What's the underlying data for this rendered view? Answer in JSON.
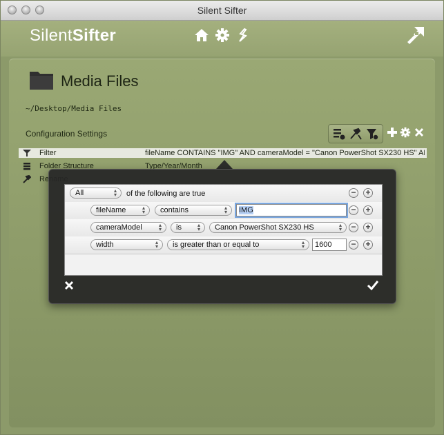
{
  "window": {
    "title": "Silent Sifter"
  },
  "header": {
    "logo_light": "Silent",
    "logo_bold": "Sifter",
    "nav": [
      "home-icon",
      "gear-icon",
      "sifter-icon"
    ],
    "corner_icon": "network-icon"
  },
  "media": {
    "title": "Media Files",
    "path": "~/Desktop/Media Files"
  },
  "config": {
    "label": "Configuration Settings",
    "toolbar": [
      "filter-list-icon",
      "rename-tool-icon",
      "filter-icon"
    ],
    "actions": [
      "add-icon",
      "gear-icon",
      "close-icon"
    ],
    "rows": [
      {
        "icon": "filter-icon",
        "name": "Filter",
        "value": "fileName CONTAINS \"IMG\" AND cameraModel = \"Canon PowerShot SX230 HS\" AND..."
      },
      {
        "icon": "list-icon",
        "name": "Folder Structure",
        "value": "Type/Year/Month"
      },
      {
        "icon": "hammer-icon",
        "name": "Rename",
        "value": ""
      }
    ]
  },
  "predicate": {
    "match_mode": "All",
    "match_suffix": "of the following are true",
    "rules": [
      {
        "field": "fileName",
        "op": "contains",
        "value": "IMG"
      },
      {
        "field": "cameraModel",
        "op": "is",
        "value": "Canon PowerShot SX230 HS"
      },
      {
        "field": "width",
        "op": "is greater than or equal to",
        "value": "1600"
      }
    ],
    "minus": "−",
    "plus": "+"
  },
  "colors": {
    "accent": "#8c9a6a",
    "popover": "#262626",
    "selection": "#b5cff5"
  }
}
